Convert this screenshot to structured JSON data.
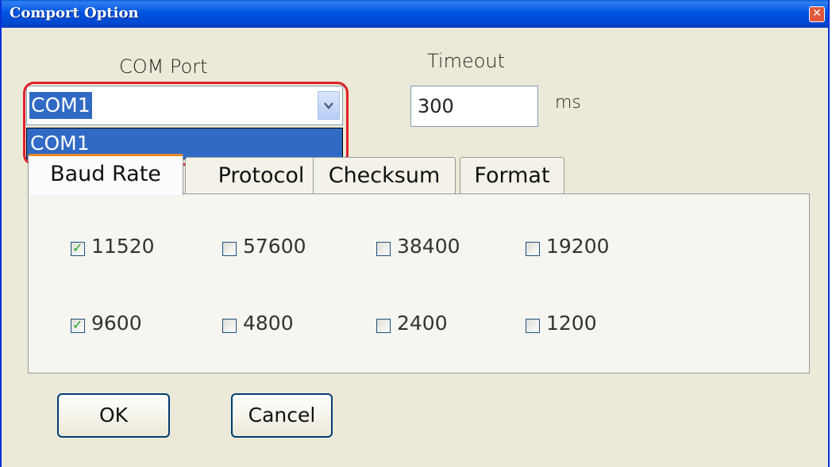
{
  "window": {
    "title": "Comport Option",
    "close_glyph": "✕"
  },
  "com_port": {
    "label": "COM Port",
    "value": "COM1",
    "options": [
      "COM1"
    ]
  },
  "timeout": {
    "label": "Timeout",
    "value": "300",
    "unit": "ms"
  },
  "tabs": [
    {
      "label": "Baud Rate",
      "active": true
    },
    {
      "label": "Protocol",
      "active": false
    },
    {
      "label": "Checksum",
      "active": false
    },
    {
      "label": "Format",
      "active": false
    }
  ],
  "baud_rates": [
    {
      "label": "11520",
      "checked": true
    },
    {
      "label": "57600",
      "checked": false
    },
    {
      "label": "38400",
      "checked": false
    },
    {
      "label": "19200",
      "checked": false
    },
    {
      "label": "9600",
      "checked": true
    },
    {
      "label": "4800",
      "checked": false
    },
    {
      "label": "2400",
      "checked": false
    },
    {
      "label": "1200",
      "checked": false
    }
  ],
  "buttons": {
    "ok": "OK",
    "cancel": "Cancel"
  },
  "check_glyph": "✓",
  "colors": {
    "title_bar": "#0054e3",
    "highlight": "#316ac5",
    "annotation_red": "#e0202a",
    "dialog_bg": "#ece9d8"
  }
}
